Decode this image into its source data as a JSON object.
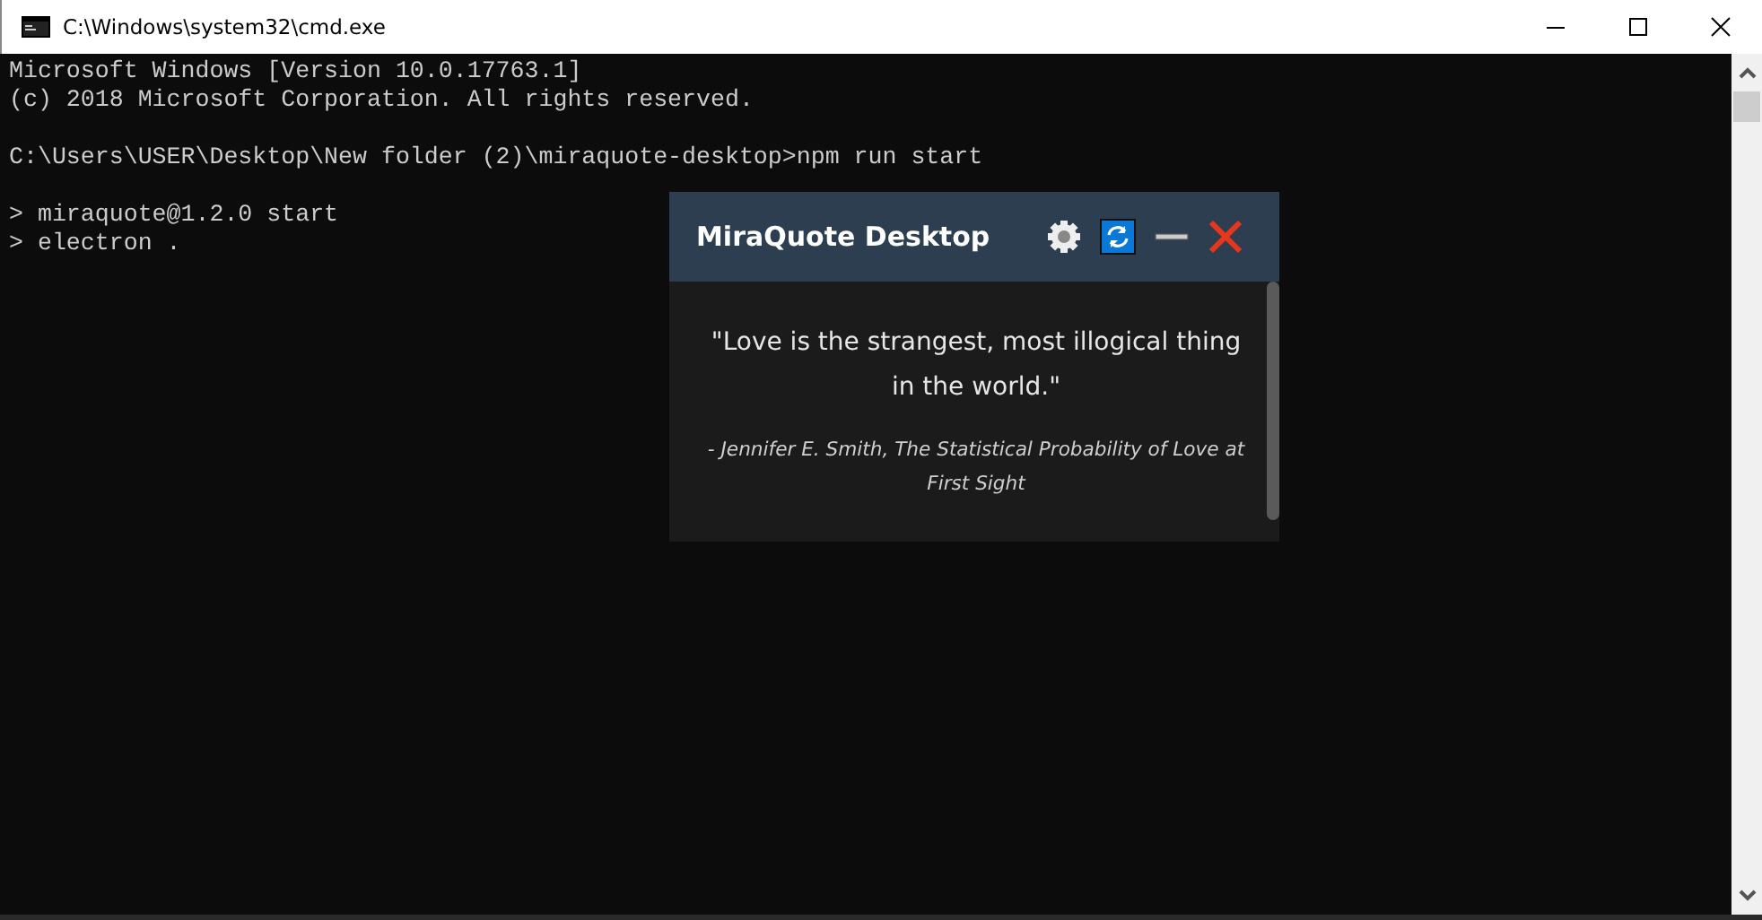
{
  "window": {
    "title": "C:\\Windows\\system32\\cmd.exe"
  },
  "console_blocks": [
    [
      "Microsoft Windows [Version 10.0.17763.1]",
      "(c) 2018 Microsoft Corporation. All rights reserved."
    ],
    [
      "C:\\Users\\USER\\Desktop\\New folder (2)\\miraquote-desktop>npm run start"
    ],
    [
      "> miraquote@1.2.0 start",
      "> electron ."
    ]
  ],
  "app": {
    "title": "MiraQuote Desktop",
    "quote": "\"Love is the strangest, most illogical thing in the world.\"",
    "attribution": "- Jennifer E. Smith, The Statistical Probability of Love at First Sight"
  }
}
